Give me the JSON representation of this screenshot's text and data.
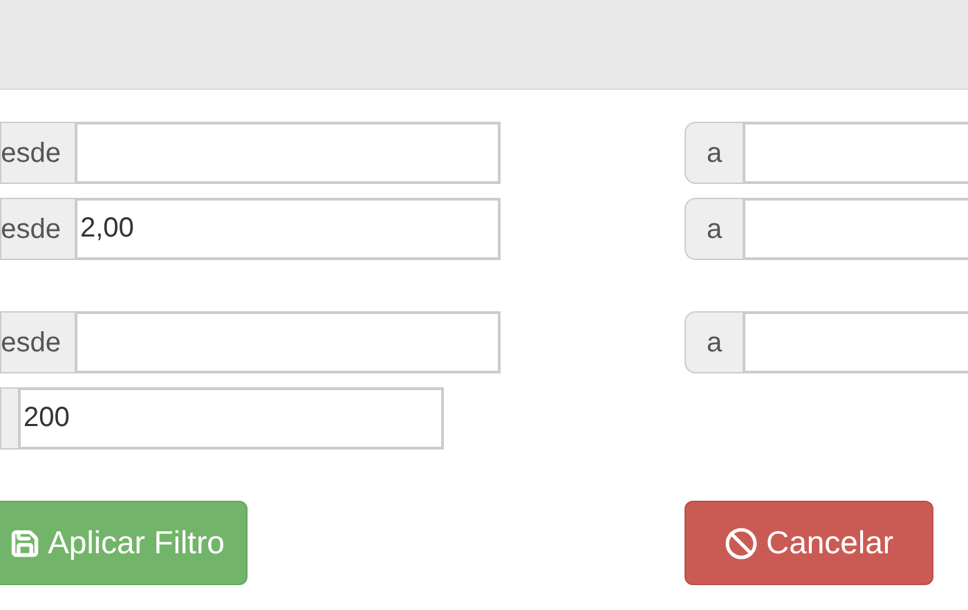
{
  "rows": [
    {
      "from": {
        "addon": "esde"
      },
      "to": {
        "addon": "a"
      }
    },
    {
      "from": {
        "addon": "esde",
        "value": "2,00"
      },
      "to": {
        "addon": "a"
      }
    },
    {
      "from": {
        "addon": "esde"
      },
      "to": {
        "addon": "a"
      }
    },
    {
      "from": {
        "value": "200"
      }
    }
  ],
  "buttons": [
    {
      "label": "Aplicar Filtro",
      "kind": "apply"
    },
    {
      "label": "Cancelar",
      "kind": "cancel"
    }
  ]
}
